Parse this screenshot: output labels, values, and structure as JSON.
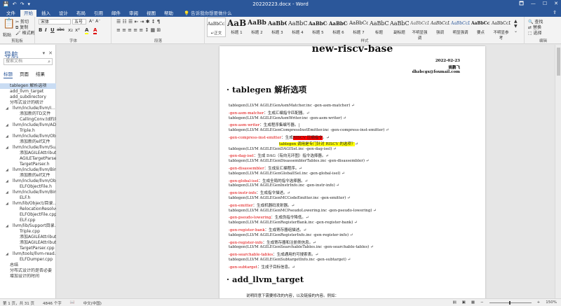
{
  "titlebar": {
    "title": "20220223.docx - Word",
    "qat": [
      "💾",
      "↶",
      "↷",
      "▾"
    ],
    "window_buttons": [
      "🗖",
      "—",
      "☐",
      "✕"
    ]
  },
  "tabs": [
    "文件",
    "开始",
    "插入",
    "设计",
    "布局",
    "引用",
    "邮件",
    "审阅",
    "视图",
    "帮助"
  ],
  "active_tab_index": 1,
  "tell_me": "告诉我你想要做什么",
  "ribbon": {
    "clipboard": {
      "paste": "粘贴",
      "cut": "剪切",
      "copy": "复制",
      "format_painter": "格式刷",
      "label": "剪贴板"
    },
    "font": {
      "name": "宋体",
      "size": "五号",
      "label": "字体",
      "format": [
        "B",
        "I",
        "U",
        "abc",
        "x₂",
        "x²",
        "A",
        "A"
      ]
    },
    "paragraph": {
      "label": "段落"
    },
    "styles": {
      "label": "样式",
      "items": [
        {
          "sample": "AaBbCcDt",
          "name": "↵正文"
        },
        {
          "sample": "AaBl",
          "name": "标题 1"
        },
        {
          "sample": "AaBb",
          "name": "标题 2"
        },
        {
          "sample": "AaBbC",
          "name": "标题 3"
        },
        {
          "sample": "AaBbC",
          "name": "标题 4"
        },
        {
          "sample": "AaBbCc",
          "name": "标题 5"
        },
        {
          "sample": "AaBbCc",
          "name": "标题 6"
        },
        {
          "sample": "AaBbCc",
          "name": "标题 7"
        },
        {
          "sample": "AaBbC",
          "name": "标题"
        },
        {
          "sample": "AaBbC",
          "name": "副标题"
        },
        {
          "sample": "AaBbCcD",
          "name": "不明显强调"
        },
        {
          "sample": "AaBbCcD",
          "name": "强调"
        },
        {
          "sample": "AaBbCcD",
          "name": "明显强调"
        },
        {
          "sample": "AaBbCcD",
          "name": "要点"
        },
        {
          "sample": "AaBbCcD",
          "name": "不明显参考"
        }
      ]
    },
    "editing": {
      "find": "查找",
      "replace": "替换",
      "select": "选择",
      "label": "编辑"
    }
  },
  "nav": {
    "title": "导航",
    "search_placeholder": "搜索文档",
    "tabs": [
      "标题",
      "页面",
      "结果"
    ],
    "items": [
      {
        "text": "tablegen 解析选项",
        "level": 1,
        "selected": true
      },
      {
        "text": "add_llvm_target",
        "level": 1
      },
      {
        "text": "add_subdirectory",
        "level": 1
      },
      {
        "text": "分布式设计的统计",
        "level": 1
      },
      {
        "text": "llvm/include/llvm/I...",
        "level": 2,
        "exp": true
      },
      {
        "text": "添加新的TD文件",
        "level": 3
      },
      {
        "text": "CallingConv.td的问题",
        "level": 3
      },
      {
        "text": "llvm/include/llvm/AD...",
        "level": 2,
        "exp": true
      },
      {
        "text": "Triple.h",
        "level": 3
      },
      {
        "text": "llvm/include/llvm/Ob...",
        "level": 2,
        "exp": true
      },
      {
        "text": "添加新的elf文件",
        "level": 3
      },
      {
        "text": "llvm/include/llvm/Su...",
        "level": 2,
        "exp": true
      },
      {
        "text": "添加AGILEAttribut...",
        "level": 3
      },
      {
        "text": "AGILETargetParse...",
        "level": 3
      },
      {
        "text": "TargetParser.h",
        "level": 3
      },
      {
        "text": "llvm/include/llvm/BinaryF...",
        "level": 2,
        "exp": true
      },
      {
        "text": "添加新的elf文件",
        "level": 3
      },
      {
        "text": "llvm/include/llvm/Obj...",
        "level": 2,
        "exp": true
      },
      {
        "text": "ELFObjectFile.h",
        "level": 3
      },
      {
        "text": "llvm/include/llvm/BinaryF...",
        "level": 2,
        "exp": true
      },
      {
        "text": "ELF.h",
        "level": 3
      },
      {
        "text": "llvm/lib/Object/目录...",
        "level": 2,
        "exp": true
      },
      {
        "text": "RelocationResolve...",
        "level": 3
      },
      {
        "text": "ELFObjectFile.cpp",
        "level": 3
      },
      {
        "text": "ELF.cpp",
        "level": 3
      },
      {
        "text": "llvm/lib/Support目录...",
        "level": 2,
        "exp": true
      },
      {
        "text": "Triple.cpp",
        "level": 3
      },
      {
        "text": "添加AGILEAttribut...",
        "level": 3
      },
      {
        "text": "添加AGILEAttribut...",
        "level": 3
      },
      {
        "text": "TargetParser.cpp",
        "level": 3
      },
      {
        "text": "llvm/tools/llvm-read...",
        "level": 2,
        "exp": true
      },
      {
        "text": "ELFDumper.cpp",
        "level": 3
      },
      {
        "text": "总结",
        "level": 1
      },
      {
        "text": "分布式设计的是否必要",
        "level": 1
      },
      {
        "text": "增加设计的时间",
        "level": 1
      }
    ]
  },
  "document": {
    "title": "new-riscv-base",
    "date": "2022-02-23",
    "author": "姚鹏飞",
    "email": "dhzbcgx@foxmail.com",
    "section1": "tablegen 解析选项",
    "section2": "add_llvm_target",
    "lines": [
      {
        "a": "tablegen(LLVM AGILEGenAsmMatcher.inc -gen-asm-matcher) ↵"
      },
      {
        "opt": "-gen-asm-matcher",
        "b": "：生成汇编指令匹配器。↵"
      },
      {
        "a": "tablegen(LLVM AGILEGenAsmWriter.inc -gen-asm-writer) ↵"
      },
      {
        "opt": "-gen-asm-writer",
        "b": "：生成程序集编写器。|"
      },
      {
        "a": "tablegen(LLVM AGILEGenCompressInstEmitter.inc -gen-compress-inst-emitter) ↵"
      },
      {
        "opt": "-gen-compress-inst-emitter",
        "b": "：生成",
        "red": "RISCV 压缩指令",
        "c": "。↵"
      },
      {
        "yellow": "tablegen 调用是专门针对 RISCV 的选项？",
        "c": "↵",
        "indent": true
      },
      {
        "a": "tablegen(LLVM AGILEGenDAGISel.inc -gen-dag-isel) ↵"
      },
      {
        "opt": "-gen-dag-isel",
        "b": "：生成 DAG（有向无环图）指令选择器。↵"
      },
      {
        "a": "tablegen(LLVM AGILEGenDisassemblerTables.inc -gen-disassembler) ↵"
      },
      {
        "opt": "-gen-disassembler",
        "b": "：生成反汇编程序。↵"
      },
      {
        "a": "tablegen(LLVM AGILEGenGlobalISel.inc -gen-global-isel) ↵"
      },
      {
        "opt": "-gen-global-isel",
        "b": "：生成全局的指令选择器。↵"
      },
      {
        "a": "tablegen(LLVM AGILEGenInstrInfo.inc -gen-instr-info) ↵"
      },
      {
        "opt": "-gen-instr-info",
        "b": "：生成指令描述。↵"
      },
      {
        "a": "tablegen(LLVM AGILEGenMCCodeEmitter.inc -gen-emitter) ↵"
      },
      {
        "opt": "-gen-emitter",
        "b": "：生成机器码发射器。↵"
      },
      {
        "a": "tablegen(LLVM AGILEGenMCPseudoLowering.inc -gen-pseudo-lowering) ↵"
      },
      {
        "opt": "-gen-pseudo-lowering",
        "b": "：生成伪指令降低。↵"
      },
      {
        "a": "tablegen(LLVM AGILEGenRegisterBank.inc -gen-register-bank) ↵"
      },
      {
        "opt": "-gen-register-bank",
        "b": "：生成寄存器组描述。↵"
      },
      {
        "a": "tablegen(LLVM AGILEGenRegisterInfo.inc -gen-register-info) ↵"
      },
      {
        "opt": "-gen-register-info",
        "b": "：生成寄存器和注册类信息。↵"
      },
      {
        "a": "tablegen(LLVM AGILEGenSearchableTables.inc -gen-searchable-tables) ↵"
      },
      {
        "opt": "-gen-searchable-tables",
        "b": "：生成通用的可搜索表。↵"
      },
      {
        "a": "tablegen(LLVM AGILEGenSubtargetInfo.inc -gen-subtarget) ↵"
      },
      {
        "opt": "-gen-subtarget",
        "b": "：生成子目标信息。↵"
      }
    ],
    "para_after": "说明同意下需要修改的内容，以及链接的内容。例如："
  },
  "status": {
    "page": "第 1 页，共 31 页",
    "words": "4846 个字",
    "lang_icon": "📖",
    "lang": "中文(中国)",
    "zoom": "150%"
  }
}
